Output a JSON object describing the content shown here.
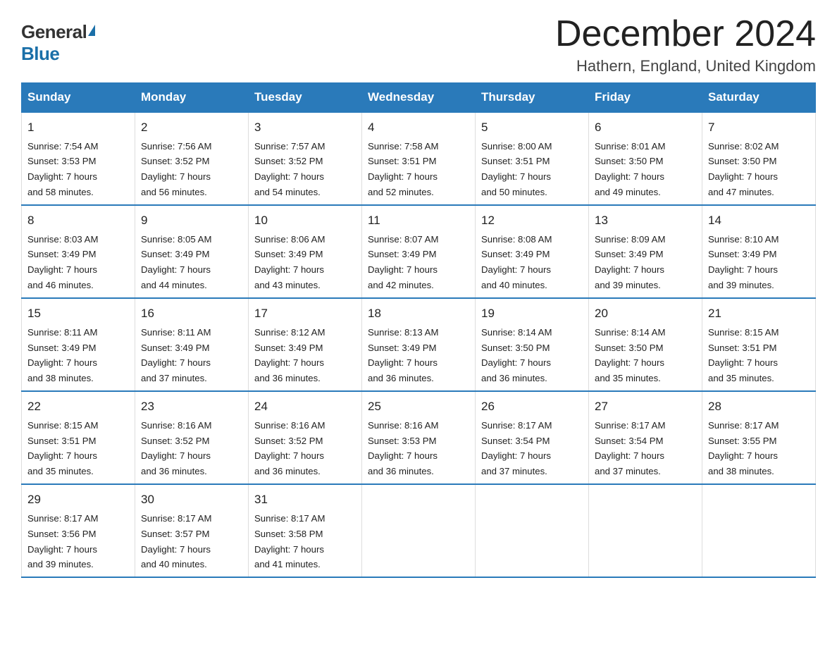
{
  "logo": {
    "general": "General",
    "blue": "Blue"
  },
  "title": "December 2024",
  "subtitle": "Hathern, England, United Kingdom",
  "days_of_week": [
    "Sunday",
    "Monday",
    "Tuesday",
    "Wednesday",
    "Thursday",
    "Friday",
    "Saturday"
  ],
  "weeks": [
    [
      {
        "day": "1",
        "sunrise": "Sunrise: 7:54 AM",
        "sunset": "Sunset: 3:53 PM",
        "daylight": "Daylight: 7 hours",
        "daylight2": "and 58 minutes."
      },
      {
        "day": "2",
        "sunrise": "Sunrise: 7:56 AM",
        "sunset": "Sunset: 3:52 PM",
        "daylight": "Daylight: 7 hours",
        "daylight2": "and 56 minutes."
      },
      {
        "day": "3",
        "sunrise": "Sunrise: 7:57 AM",
        "sunset": "Sunset: 3:52 PM",
        "daylight": "Daylight: 7 hours",
        "daylight2": "and 54 minutes."
      },
      {
        "day": "4",
        "sunrise": "Sunrise: 7:58 AM",
        "sunset": "Sunset: 3:51 PM",
        "daylight": "Daylight: 7 hours",
        "daylight2": "and 52 minutes."
      },
      {
        "day": "5",
        "sunrise": "Sunrise: 8:00 AM",
        "sunset": "Sunset: 3:51 PM",
        "daylight": "Daylight: 7 hours",
        "daylight2": "and 50 minutes."
      },
      {
        "day": "6",
        "sunrise": "Sunrise: 8:01 AM",
        "sunset": "Sunset: 3:50 PM",
        "daylight": "Daylight: 7 hours",
        "daylight2": "and 49 minutes."
      },
      {
        "day": "7",
        "sunrise": "Sunrise: 8:02 AM",
        "sunset": "Sunset: 3:50 PM",
        "daylight": "Daylight: 7 hours",
        "daylight2": "and 47 minutes."
      }
    ],
    [
      {
        "day": "8",
        "sunrise": "Sunrise: 8:03 AM",
        "sunset": "Sunset: 3:49 PM",
        "daylight": "Daylight: 7 hours",
        "daylight2": "and 46 minutes."
      },
      {
        "day": "9",
        "sunrise": "Sunrise: 8:05 AM",
        "sunset": "Sunset: 3:49 PM",
        "daylight": "Daylight: 7 hours",
        "daylight2": "and 44 minutes."
      },
      {
        "day": "10",
        "sunrise": "Sunrise: 8:06 AM",
        "sunset": "Sunset: 3:49 PM",
        "daylight": "Daylight: 7 hours",
        "daylight2": "and 43 minutes."
      },
      {
        "day": "11",
        "sunrise": "Sunrise: 8:07 AM",
        "sunset": "Sunset: 3:49 PM",
        "daylight": "Daylight: 7 hours",
        "daylight2": "and 42 minutes."
      },
      {
        "day": "12",
        "sunrise": "Sunrise: 8:08 AM",
        "sunset": "Sunset: 3:49 PM",
        "daylight": "Daylight: 7 hours",
        "daylight2": "and 40 minutes."
      },
      {
        "day": "13",
        "sunrise": "Sunrise: 8:09 AM",
        "sunset": "Sunset: 3:49 PM",
        "daylight": "Daylight: 7 hours",
        "daylight2": "and 39 minutes."
      },
      {
        "day": "14",
        "sunrise": "Sunrise: 8:10 AM",
        "sunset": "Sunset: 3:49 PM",
        "daylight": "Daylight: 7 hours",
        "daylight2": "and 39 minutes."
      }
    ],
    [
      {
        "day": "15",
        "sunrise": "Sunrise: 8:11 AM",
        "sunset": "Sunset: 3:49 PM",
        "daylight": "Daylight: 7 hours",
        "daylight2": "and 38 minutes."
      },
      {
        "day": "16",
        "sunrise": "Sunrise: 8:11 AM",
        "sunset": "Sunset: 3:49 PM",
        "daylight": "Daylight: 7 hours",
        "daylight2": "and 37 minutes."
      },
      {
        "day": "17",
        "sunrise": "Sunrise: 8:12 AM",
        "sunset": "Sunset: 3:49 PM",
        "daylight": "Daylight: 7 hours",
        "daylight2": "and 36 minutes."
      },
      {
        "day": "18",
        "sunrise": "Sunrise: 8:13 AM",
        "sunset": "Sunset: 3:49 PM",
        "daylight": "Daylight: 7 hours",
        "daylight2": "and 36 minutes."
      },
      {
        "day": "19",
        "sunrise": "Sunrise: 8:14 AM",
        "sunset": "Sunset: 3:50 PM",
        "daylight": "Daylight: 7 hours",
        "daylight2": "and 36 minutes."
      },
      {
        "day": "20",
        "sunrise": "Sunrise: 8:14 AM",
        "sunset": "Sunset: 3:50 PM",
        "daylight": "Daylight: 7 hours",
        "daylight2": "and 35 minutes."
      },
      {
        "day": "21",
        "sunrise": "Sunrise: 8:15 AM",
        "sunset": "Sunset: 3:51 PM",
        "daylight": "Daylight: 7 hours",
        "daylight2": "and 35 minutes."
      }
    ],
    [
      {
        "day": "22",
        "sunrise": "Sunrise: 8:15 AM",
        "sunset": "Sunset: 3:51 PM",
        "daylight": "Daylight: 7 hours",
        "daylight2": "and 35 minutes."
      },
      {
        "day": "23",
        "sunrise": "Sunrise: 8:16 AM",
        "sunset": "Sunset: 3:52 PM",
        "daylight": "Daylight: 7 hours",
        "daylight2": "and 36 minutes."
      },
      {
        "day": "24",
        "sunrise": "Sunrise: 8:16 AM",
        "sunset": "Sunset: 3:52 PM",
        "daylight": "Daylight: 7 hours",
        "daylight2": "and 36 minutes."
      },
      {
        "day": "25",
        "sunrise": "Sunrise: 8:16 AM",
        "sunset": "Sunset: 3:53 PM",
        "daylight": "Daylight: 7 hours",
        "daylight2": "and 36 minutes."
      },
      {
        "day": "26",
        "sunrise": "Sunrise: 8:17 AM",
        "sunset": "Sunset: 3:54 PM",
        "daylight": "Daylight: 7 hours",
        "daylight2": "and 37 minutes."
      },
      {
        "day": "27",
        "sunrise": "Sunrise: 8:17 AM",
        "sunset": "Sunset: 3:54 PM",
        "daylight": "Daylight: 7 hours",
        "daylight2": "and 37 minutes."
      },
      {
        "day": "28",
        "sunrise": "Sunrise: 8:17 AM",
        "sunset": "Sunset: 3:55 PM",
        "daylight": "Daylight: 7 hours",
        "daylight2": "and 38 minutes."
      }
    ],
    [
      {
        "day": "29",
        "sunrise": "Sunrise: 8:17 AM",
        "sunset": "Sunset: 3:56 PM",
        "daylight": "Daylight: 7 hours",
        "daylight2": "and 39 minutes."
      },
      {
        "day": "30",
        "sunrise": "Sunrise: 8:17 AM",
        "sunset": "Sunset: 3:57 PM",
        "daylight": "Daylight: 7 hours",
        "daylight2": "and 40 minutes."
      },
      {
        "day": "31",
        "sunrise": "Sunrise: 8:17 AM",
        "sunset": "Sunset: 3:58 PM",
        "daylight": "Daylight: 7 hours",
        "daylight2": "and 41 minutes."
      },
      null,
      null,
      null,
      null
    ]
  ]
}
